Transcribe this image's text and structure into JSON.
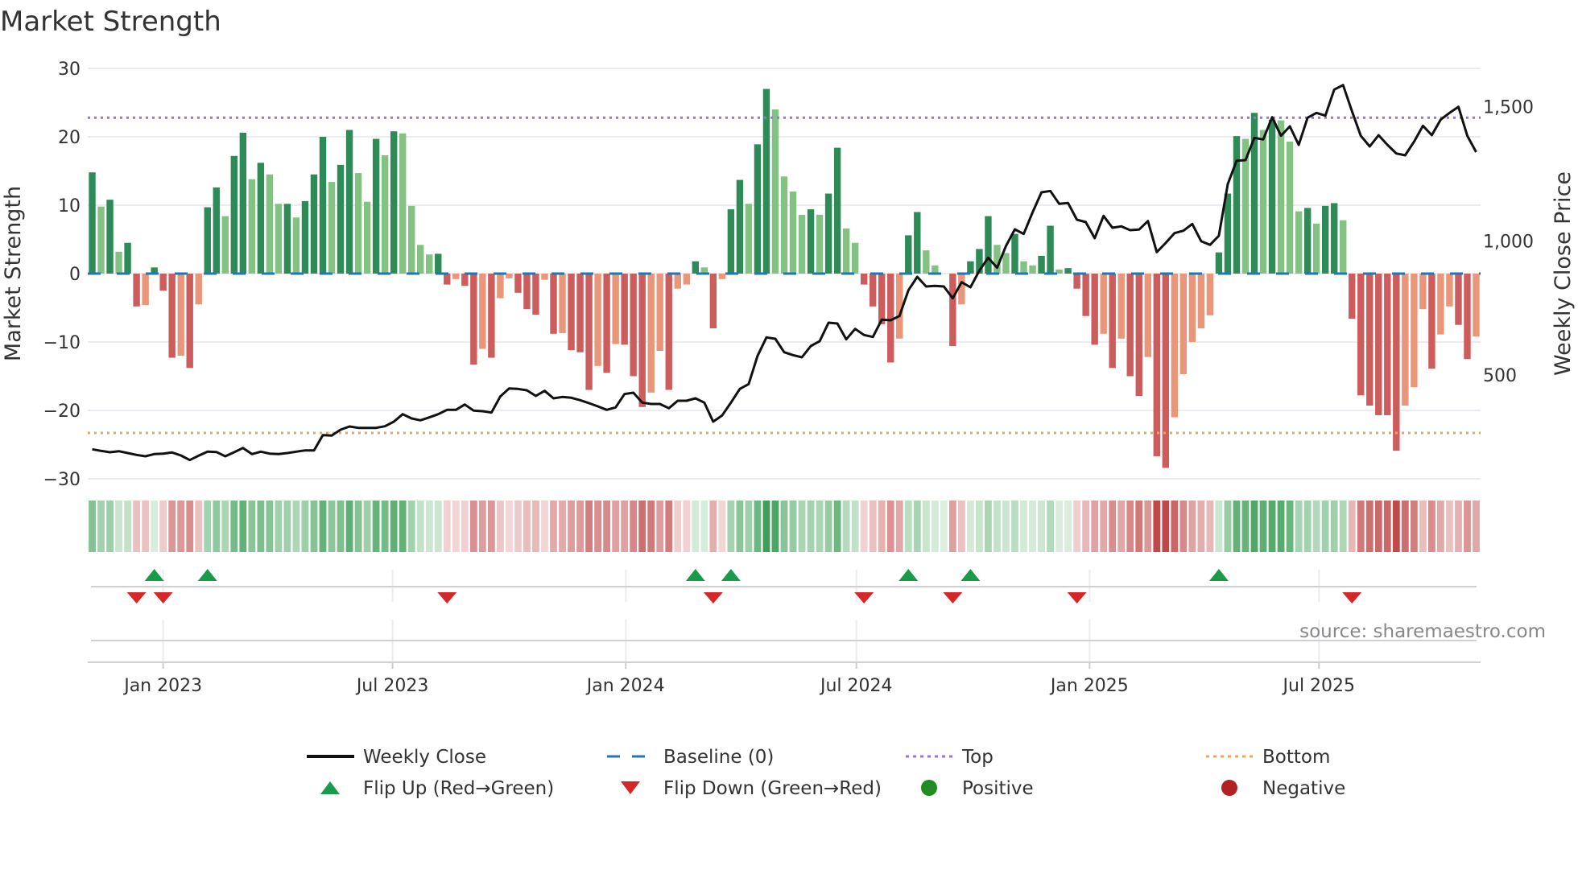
{
  "chart_data": {
    "type": "bar",
    "title": "Market Strength",
    "ylabel": "Market Strength",
    "y2label": "Weekly Close Price",
    "ylim": [
      -30,
      30
    ],
    "y2lim": [
      113,
      1643
    ],
    "yticks": [
      30,
      20,
      10,
      0,
      -10,
      -20,
      -30
    ],
    "ytick_labels": [
      "30",
      "20",
      "10",
      "0",
      "−10",
      "−20",
      "−30"
    ],
    "y2ticks": [
      500,
      1000,
      1500
    ],
    "y2tick_labels": [
      "500",
      "1,000",
      "1,500"
    ],
    "frequency": "weekly",
    "start_date": "2022-11-06",
    "xticks": [
      {
        "date": "2023-01-01",
        "label": "Jan 2023"
      },
      {
        "date": "2023-07-01",
        "label": "Jul 2023"
      },
      {
        "date": "2024-01-01",
        "label": "Jan 2024"
      },
      {
        "date": "2024-07-01",
        "label": "Jul 2024"
      },
      {
        "date": "2025-01-01",
        "label": "Jan 2025"
      },
      {
        "date": "2025-07-01",
        "label": "Jul 2025"
      }
    ],
    "top_level": 22.8,
    "bottom_level": -23.3,
    "grid": true,
    "strength": [
      14.8,
      9.8,
      10.8,
      3.2,
      4.5,
      -4.8,
      -4.6,
      0.9,
      -2.5,
      -12.3,
      -12,
      -13.8,
      -4.5,
      9.7,
      12.6,
      8.4,
      17.2,
      20.6,
      13.8,
      16.2,
      14.5,
      10.2,
      10.2,
      8.2,
      10.6,
      14.5,
      20,
      13.4,
      15.9,
      21,
      14.7,
      10.5,
      19.7,
      17.3,
      20.8,
      20.5,
      9.9,
      4.2,
      2.8,
      2.9,
      -1.6,
      -0.8,
      -1.8,
      -13.3,
      -11,
      -12.3,
      -3.6,
      -0.7,
      -2.8,
      -5.2,
      -6,
      -0.9,
      -8.8,
      -8.7,
      -11.2,
      -11.5,
      -17,
      -13.5,
      -14.5,
      -10.3,
      -10.4,
      -15,
      -19.5,
      -17.4,
      -11.3,
      -17,
      -2.2,
      -1.6,
      1.8,
      0.9,
      -8,
      -0.8,
      9.4,
      13.7,
      10.2,
      18.9,
      27,
      24,
      14.2,
      12,
      8.6,
      9.4,
      8.6,
      11.7,
      18.4,
      6.6,
      4.5,
      -1.6,
      -4.8,
      -7.4,
      -13,
      -9.5,
      5.6,
      9,
      3.4,
      1.2,
      0,
      -10.6,
      -4.5,
      1.8,
      3.6,
      8.4,
      4.2,
      3,
      5.8,
      1.8,
      1.2,
      2.6,
      7,
      0.6,
      0.8,
      -2.2,
      -6.2,
      -10.4,
      -8.8,
      -13.8,
      -9.5,
      -15,
      -17.9,
      -12.2,
      -26.7,
      -28.4,
      -21,
      -14.7,
      -10,
      -8,
      -6.1,
      3.1,
      11.7,
      20.1,
      19.7,
      23.5,
      21,
      22.5,
      22.4,
      19.3,
      9.1,
      9.6,
      7.3,
      9.9,
      10.3,
      7.8,
      -6.6,
      -17.8,
      -19.3,
      -20.7,
      -20.7,
      -25.9,
      -19.3,
      -16.6,
      -5.2,
      -13.9,
      -8.9,
      -4.8,
      -7.5,
      -12.5,
      -9.2
    ],
    "weekly_close": [
      223,
      217,
      212,
      216,
      209,
      202,
      197,
      205,
      207,
      211,
      200,
      183,
      199,
      214,
      213,
      197,
      212,
      228,
      205,
      214,
      207,
      205,
      209,
      214,
      219,
      219,
      276,
      274,
      296,
      308,
      303,
      303,
      303,
      309,
      326,
      354,
      338,
      331,
      342,
      354,
      370,
      370,
      390,
      367,
      365,
      360,
      420,
      450,
      448,
      443,
      422,
      441,
      413,
      418,
      415,
      406,
      395,
      383,
      370,
      379,
      429,
      434,
      397,
      392,
      392,
      376,
      404,
      404,
      413,
      397,
      326,
      349,
      397,
      448,
      466,
      571,
      640,
      635,
      585,
      574,
      566,
      608,
      626,
      695,
      692,
      633,
      672,
      649,
      642,
      706,
      704,
      720,
      816,
      866,
      830,
      832,
      830,
      786,
      846,
      827,
      889,
      937,
      900,
      981,
      1043,
      1026,
      1106,
      1181,
      1186,
      1138,
      1141,
      1079,
      1070,
      1010,
      1093,
      1049,
      1054,
      1040,
      1042,
      1074,
      958,
      992,
      1029,
      1038,
      1063,
      999,
      985,
      1019,
      1212,
      1299,
      1301,
      1384,
      1378,
      1461,
      1392,
      1427,
      1358,
      1459,
      1477,
      1467,
      1564,
      1581,
      1484,
      1392,
      1352,
      1394,
      1358,
      1326,
      1319,
      1370,
      1429,
      1394,
      1452,
      1477,
      1500,
      1392,
      1331
    ],
    "flip_up_weeks": [
      7,
      13,
      68,
      72,
      92,
      99,
      127
    ],
    "flip_down_weeks": [
      5,
      8,
      40,
      70,
      87,
      97,
      111,
      142
    ],
    "legend_position": "bottom",
    "legend": [
      {
        "key": "weekly_close",
        "label": "Weekly Close"
      },
      {
        "key": "baseline",
        "label": "Baseline (0)"
      },
      {
        "key": "top",
        "label": "Top"
      },
      {
        "key": "bottom",
        "label": "Bottom"
      },
      {
        "key": "flip_up",
        "label": "Flip Up (Red→Green)"
      },
      {
        "key": "flip_down",
        "label": "Flip Down (Green→Red)"
      },
      {
        "key": "positive",
        "label": "Positive"
      },
      {
        "key": "negative",
        "label": "Negative"
      }
    ],
    "source": "source: sharemaestro.com",
    "colors": {
      "pos_strong": "#2e8a57",
      "pos_weak": "#84c283",
      "neg_strong": "#cd5c5c",
      "neg_weak": "#e9967a",
      "line": "#111111",
      "baseline": "#1f77b4",
      "top": "#9f6ee0",
      "bottom": "#f0a35a",
      "flip_up": "#1a9a4a",
      "flip_down": "#d62728",
      "positive": "#228b22",
      "negative": "#b22222",
      "grid": "#ebebf2"
    }
  }
}
